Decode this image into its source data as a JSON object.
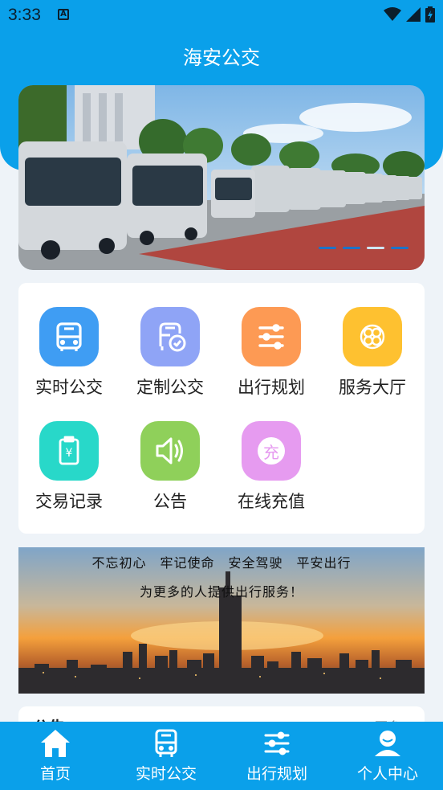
{
  "status": {
    "time": "3:33",
    "notif_icon": "A"
  },
  "app": {
    "title": "海安公交"
  },
  "banner": {
    "dots": 4,
    "active_dot": 3
  },
  "grid": [
    {
      "label": "实时公交",
      "icon": "bus-icon",
      "color": "#3f9df3"
    },
    {
      "label": "定制公交",
      "icon": "custom-bus-icon",
      "color": "#8fa4f6"
    },
    {
      "label": "出行规划",
      "icon": "sliders-icon",
      "color": "#fd9a54"
    },
    {
      "label": "服务大厅",
      "icon": "flower-icon",
      "color": "#fec130"
    },
    {
      "label": "交易记录",
      "icon": "receipt-icon",
      "color": "#28d8c9"
    },
    {
      "label": "公告",
      "icon": "speaker-icon",
      "color": "#8fd05a"
    },
    {
      "label": "在线充值",
      "icon": "recharge-icon",
      "color": "#e69bf0",
      "glyph": "充"
    }
  ],
  "promo": {
    "line1": "不忘初心　牢记使命　安全驾驶　平安出行",
    "line2": "为更多的人提供出行服务！"
  },
  "notice": {
    "title": "公告",
    "more": "更多"
  },
  "tabbar": [
    {
      "label": "首页",
      "icon": "home-icon"
    },
    {
      "label": "实时公交",
      "icon": "bus-icon"
    },
    {
      "label": "出行规划",
      "icon": "sliders-icon"
    },
    {
      "label": "个人中心",
      "icon": "user-icon"
    }
  ]
}
